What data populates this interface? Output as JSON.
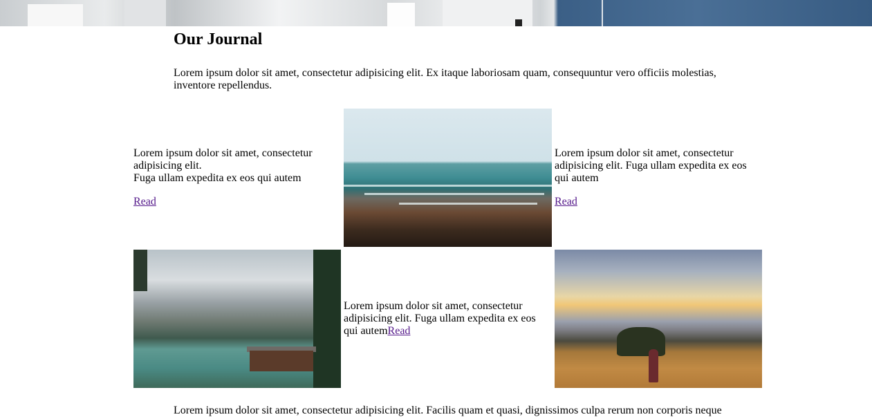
{
  "header": {
    "title": "Our Journal",
    "intro": "Lorem ipsum dolor sit amet, consectetur adipisicing elit. Ex itaque laboriosam quam, consequuntur vero officiis molestias, inventore repellendus."
  },
  "row1": {
    "left": {
      "line1": "Lorem ipsum dolor sit amet, consectetur adipisicing elit.",
      "line2": "Fuga ullam expedita ex eos qui autem",
      "link": "Read"
    },
    "right": {
      "text": "Lorem ipsum dolor sit amet, consectetur adipisicing elit. Fuga ullam expedita ex eos qui autem",
      "link": "Read"
    }
  },
  "row2": {
    "middle": {
      "text": "Lorem ipsum dolor sit amet, consectetur adipisicing elit. Fuga ullam expedita ex eos qui autem",
      "link": "Read"
    }
  },
  "footer": {
    "text": "Lorem ipsum dolor sit amet, consectetur adipisicing elit. Facilis quam et quasi, dignissimos culpa rerum non corporis neque"
  },
  "colors": {
    "link": "#551a8b",
    "text": "#000000",
    "background": "#ffffff"
  }
}
